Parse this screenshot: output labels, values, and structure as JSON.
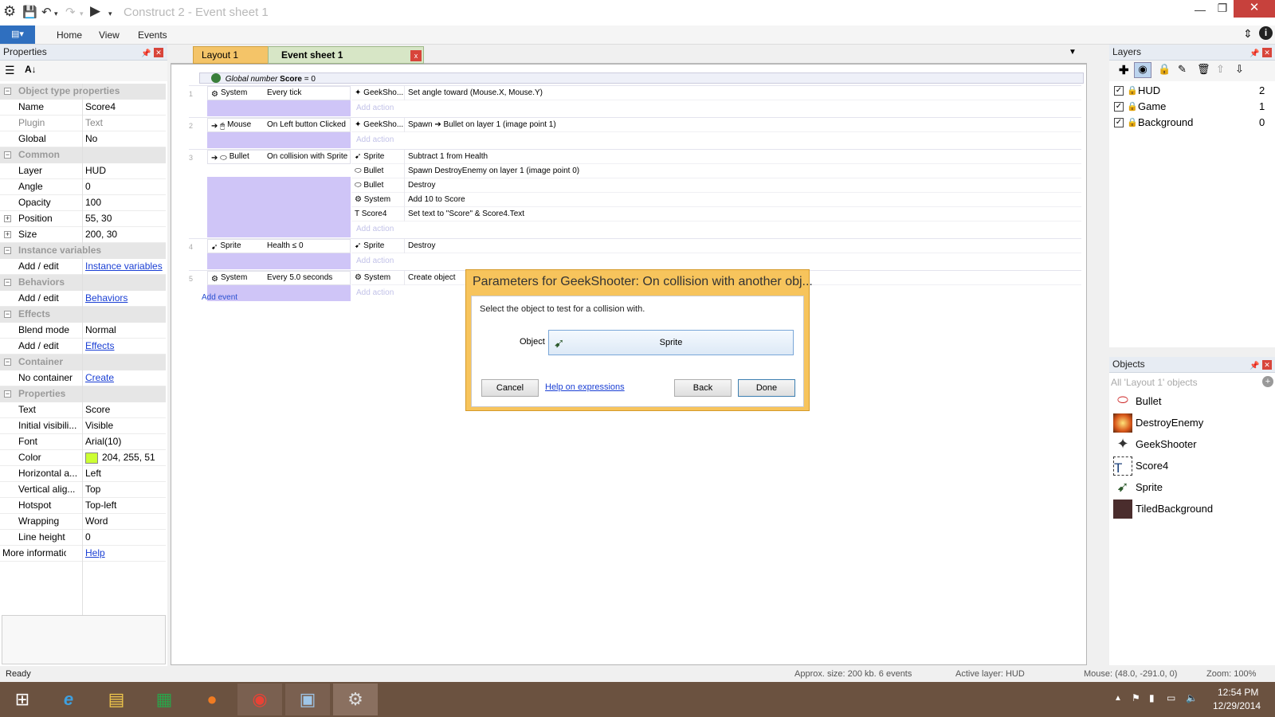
{
  "window": {
    "title": "Construct 2 - Event sheet 1"
  },
  "ribbon": {
    "file_label": "▤▾",
    "menus": [
      "Home",
      "View",
      "Events"
    ]
  },
  "properties": {
    "title": "Properties",
    "rows": [
      {
        "type": "cat",
        "label": "Object type properties"
      },
      {
        "type": "row",
        "key": "Name",
        "value": "Score4"
      },
      {
        "type": "row",
        "key": "Plugin",
        "value": "Text",
        "gray": true
      },
      {
        "type": "row",
        "key": "Global",
        "value": "No"
      },
      {
        "type": "cat",
        "label": "Common"
      },
      {
        "type": "row",
        "key": "Layer",
        "value": "HUD"
      },
      {
        "type": "row",
        "key": "Angle",
        "value": "0"
      },
      {
        "type": "row",
        "key": "Opacity",
        "value": "100"
      },
      {
        "type": "row",
        "key": "Position",
        "value": "55, 30",
        "expand": true
      },
      {
        "type": "row",
        "key": "Size",
        "value": "200, 30",
        "expand": true
      },
      {
        "type": "cat",
        "label": "Instance variables"
      },
      {
        "type": "row",
        "key": "Add / edit",
        "value": "Instance variables",
        "link": true
      },
      {
        "type": "cat",
        "label": "Behaviors"
      },
      {
        "type": "row",
        "key": "Add / edit",
        "value": "Behaviors",
        "link": true
      },
      {
        "type": "cat",
        "label": "Effects"
      },
      {
        "type": "row",
        "key": "Blend mode",
        "value": "Normal"
      },
      {
        "type": "row",
        "key": "Add / edit",
        "value": "Effects",
        "link": true
      },
      {
        "type": "cat",
        "label": "Container"
      },
      {
        "type": "row",
        "key": "No container",
        "value": "Create",
        "link": true
      },
      {
        "type": "cat",
        "label": "Properties"
      },
      {
        "type": "row",
        "key": "Text",
        "value": "Score"
      },
      {
        "type": "row",
        "key": "Initial visibili...",
        "value": "Visible"
      },
      {
        "type": "row",
        "key": "Font",
        "value": "Arial(10)"
      },
      {
        "type": "row",
        "key": "Color",
        "value": "204, 255, 51",
        "swatch": "#ccff33"
      },
      {
        "type": "row",
        "key": "Horizontal a...",
        "value": "Left"
      },
      {
        "type": "row",
        "key": "Vertical alig...",
        "value": "Top"
      },
      {
        "type": "row",
        "key": "Hotspot",
        "value": "Top-left"
      },
      {
        "type": "row",
        "key": "Wrapping",
        "value": "Word"
      },
      {
        "type": "row",
        "key": "Line height",
        "value": "0"
      },
      {
        "type": "more",
        "key": "More information",
        "value": "Help",
        "link": true
      }
    ]
  },
  "tabs": [
    {
      "label": "Layout 1",
      "active": false
    },
    {
      "label": "Event sheet 1",
      "active": true
    }
  ],
  "global_var": {
    "prefix": "Global number",
    "name": "Score",
    "suffix": "= 0"
  },
  "events": [
    {
      "num": "1",
      "obj": "System",
      "cond": "Every tick",
      "actions": [
        {
          "obj": "GeekSho...",
          "text": "Set angle toward (Mouse.X, Mouse.Y)"
        }
      ]
    },
    {
      "num": "2",
      "obj": "Mouse",
      "cond": "On Left button Clicked",
      "actions": [
        {
          "obj": "GeekSho...",
          "text": "Spawn ➔ Bullet on layer 1 (image point 1)"
        }
      ]
    },
    {
      "num": "3",
      "obj": "Bullet",
      "cond": "On collision with Sprite",
      "actions": [
        {
          "obj": "Sprite",
          "text": "Subtract 1 from Health"
        },
        {
          "obj": "Bullet",
          "text": "Spawn DestroyEnemy on layer 1 (image point 0)"
        },
        {
          "obj": "Bullet",
          "text": "Destroy"
        },
        {
          "obj": "System",
          "text": "Add 10 to Score"
        },
        {
          "obj": "Score4",
          "text": "Set text to \"Score\" & Score4.Text"
        }
      ]
    },
    {
      "num": "4",
      "obj": "Sprite",
      "cond": "Health ≤ 0",
      "actions": [
        {
          "obj": "Sprite",
          "text": "Destroy"
        }
      ]
    },
    {
      "num": "5",
      "obj": "System",
      "cond": "Every 5.0 seconds",
      "actions": [
        {
          "obj": "System",
          "text": "Create object"
        }
      ]
    }
  ],
  "add_action": "Add action",
  "add_event": "Add event",
  "layers": {
    "title": "Layers",
    "items": [
      {
        "name": "HUD",
        "index": "2"
      },
      {
        "name": "Game",
        "index": "1"
      },
      {
        "name": "Background",
        "index": "0"
      }
    ]
  },
  "objects": {
    "title": "Objects",
    "filter": "All 'Layout 1' objects",
    "items": [
      "Bullet",
      "DestroyEnemy",
      "GeekShooter",
      "Score4",
      "Sprite",
      "TiledBackground"
    ]
  },
  "dialog": {
    "title": "Parameters for GeekShooter: On collision with another obj...",
    "instruction": "Select the object to test for a collision with.",
    "object_label": "Object",
    "object_value": "Sprite",
    "cancel": "Cancel",
    "help": "Help on expressions",
    "back": "Back",
    "done": "Done"
  },
  "status": {
    "ready": "Ready",
    "size": "Approx. size: 200 kb. 6 events",
    "layer": "Active layer: HUD",
    "mouse": "Mouse: (48.0, -291.0, 0)",
    "zoom": "Zoom: 100%"
  },
  "taskbar": {
    "time": "12:54 PM",
    "date": "12/29/2014",
    "apps": [
      "windows-logo",
      "internet-explorer",
      "file-explorer",
      "store",
      "firefox",
      "chrome",
      "control-panel",
      "construct2"
    ]
  }
}
